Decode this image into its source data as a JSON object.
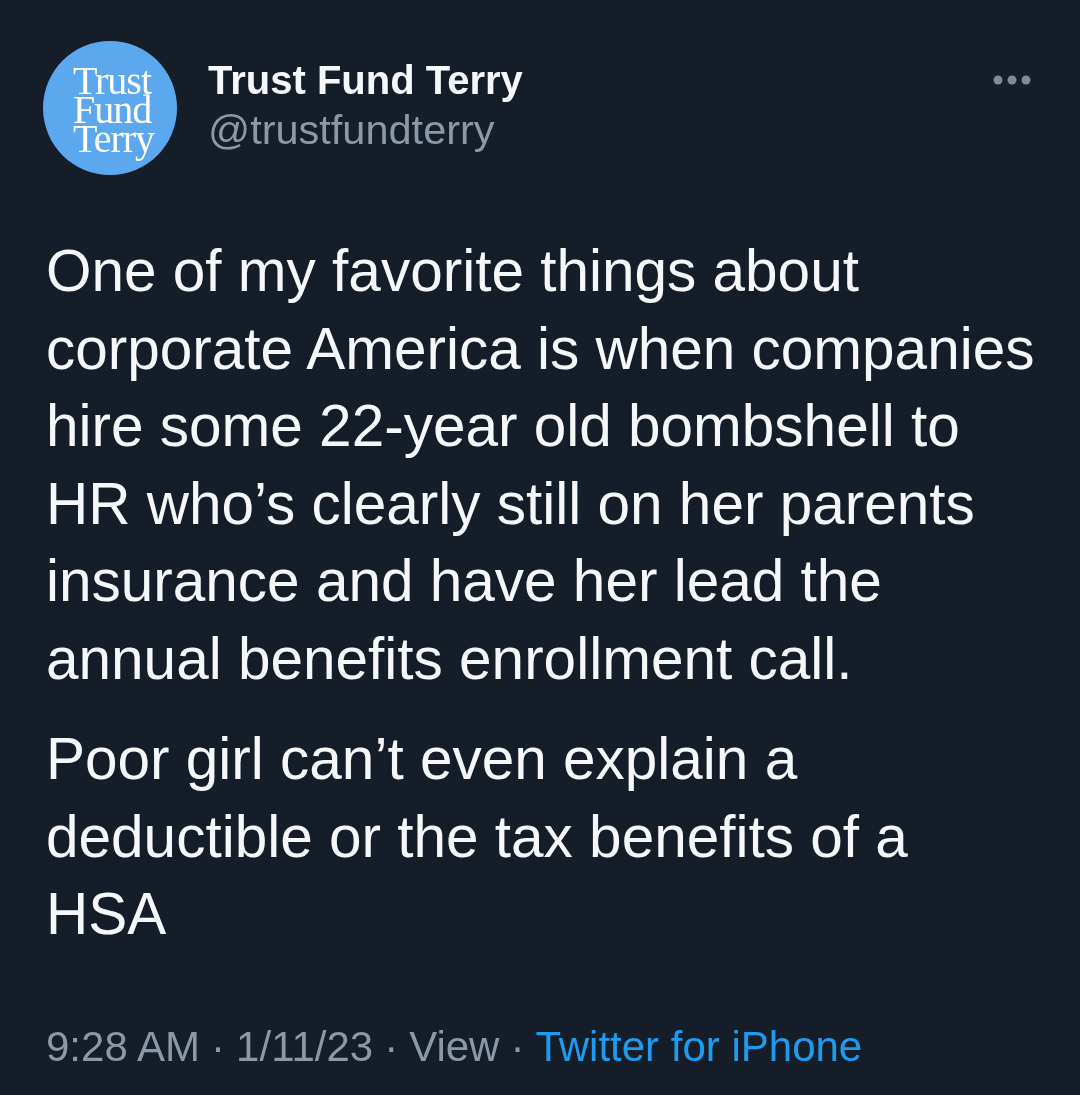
{
  "author": {
    "avatar_text": [
      "Trust",
      "Fund",
      "Terry"
    ],
    "name": "Trust Fund Terry",
    "handle": "@trustfundterry"
  },
  "tweet": {
    "paragraphs": [
      {
        "lines": [
          "One of my favorite things about",
          "corporate America is when companies",
          "hire some 22-year old bombshell to",
          "HR who’s clearly still on her parents",
          "insurance and have her lead the",
          "annual benefits enrollment call."
        ]
      },
      {
        "lines": [
          "Poor girl can’t even explain a",
          "deductible or the tax benefits of a",
          "HSA"
        ]
      }
    ]
  },
  "footer": [
    {
      "kind": "time",
      "text": "9:28 AM"
    },
    {
      "kind": "separator",
      "text": "·"
    },
    {
      "kind": "date",
      "text": "1/11/23"
    },
    {
      "kind": "separator",
      "text": "·"
    },
    {
      "kind": "views",
      "text": "View"
    },
    {
      "kind": "separator",
      "text": "·"
    },
    {
      "kind": "source",
      "text": "Twitter for iPhone"
    }
  ]
}
